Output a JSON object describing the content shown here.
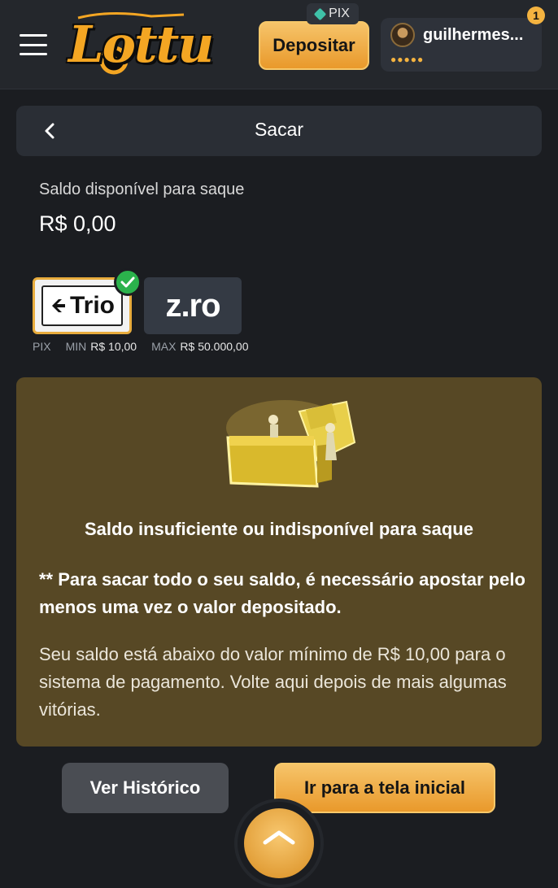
{
  "topbar": {
    "logo_text": "Lottu",
    "pix_tag": "PIX",
    "deposit_label": "Depositar",
    "username": "guilhermes...",
    "user_dots": "●●●●●",
    "notification_count": "1"
  },
  "header": {
    "title": "Sacar"
  },
  "balance": {
    "label": "Saldo disponível para saque",
    "value": "R$ 0,00"
  },
  "methods": {
    "trio_label": "Trio",
    "zro_label": "z.ro",
    "limits": {
      "type": "PIX",
      "min_label": "MIN",
      "min_value": "R$ 10,00",
      "max_label": "MAX",
      "max_value": "R$ 50.000,00"
    }
  },
  "warning": {
    "title": "Saldo insuficiente ou indisponível para saque",
    "bold_note": "** Para sacar todo o seu saldo, é necessário apostar pelo menos uma vez o valor depositado.",
    "text": "Seu saldo está abaixo do valor mínimo de R$ 10,00 para o sistema de pagamento. Volte aqui depois de mais algumas vitórias."
  },
  "actions": {
    "history_label": "Ver Histórico",
    "home_label": "Ir para a tela inicial"
  },
  "colors": {
    "accent": "#f4b340",
    "warning_bg": "#574825",
    "success": "#2bb24c"
  }
}
